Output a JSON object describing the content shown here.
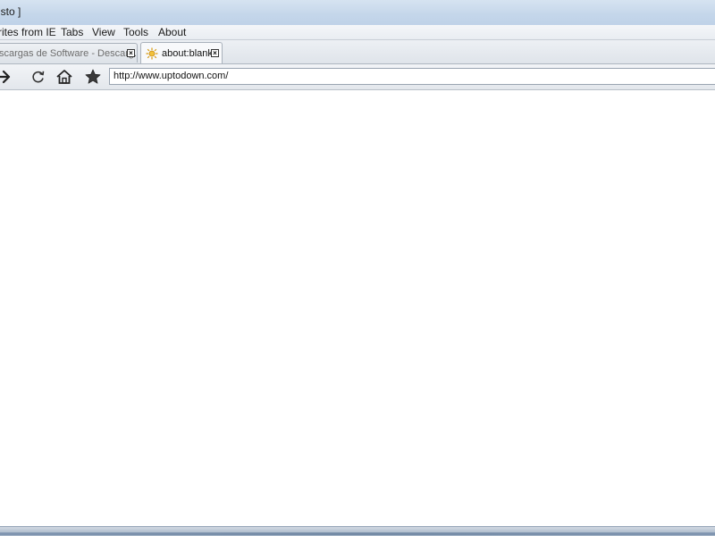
{
  "window": {
    "title": "isto ]"
  },
  "menu": {
    "items": [
      "rites from IE",
      "Tabs",
      "View",
      "Tools",
      "About"
    ]
  },
  "tabs": [
    {
      "label": "scargas de Software - Descarg...",
      "active": false
    },
    {
      "label": "about:blank",
      "active": true
    }
  ],
  "toolbar": {
    "icons": [
      "forward-arrow-icon",
      "reload-icon",
      "home-icon",
      "favorites-star-icon"
    ],
    "address_value": "http://www.uptodown.com/"
  },
  "colors": {
    "titlebar": "#c4d6ea",
    "content_background": "#ffffff"
  }
}
